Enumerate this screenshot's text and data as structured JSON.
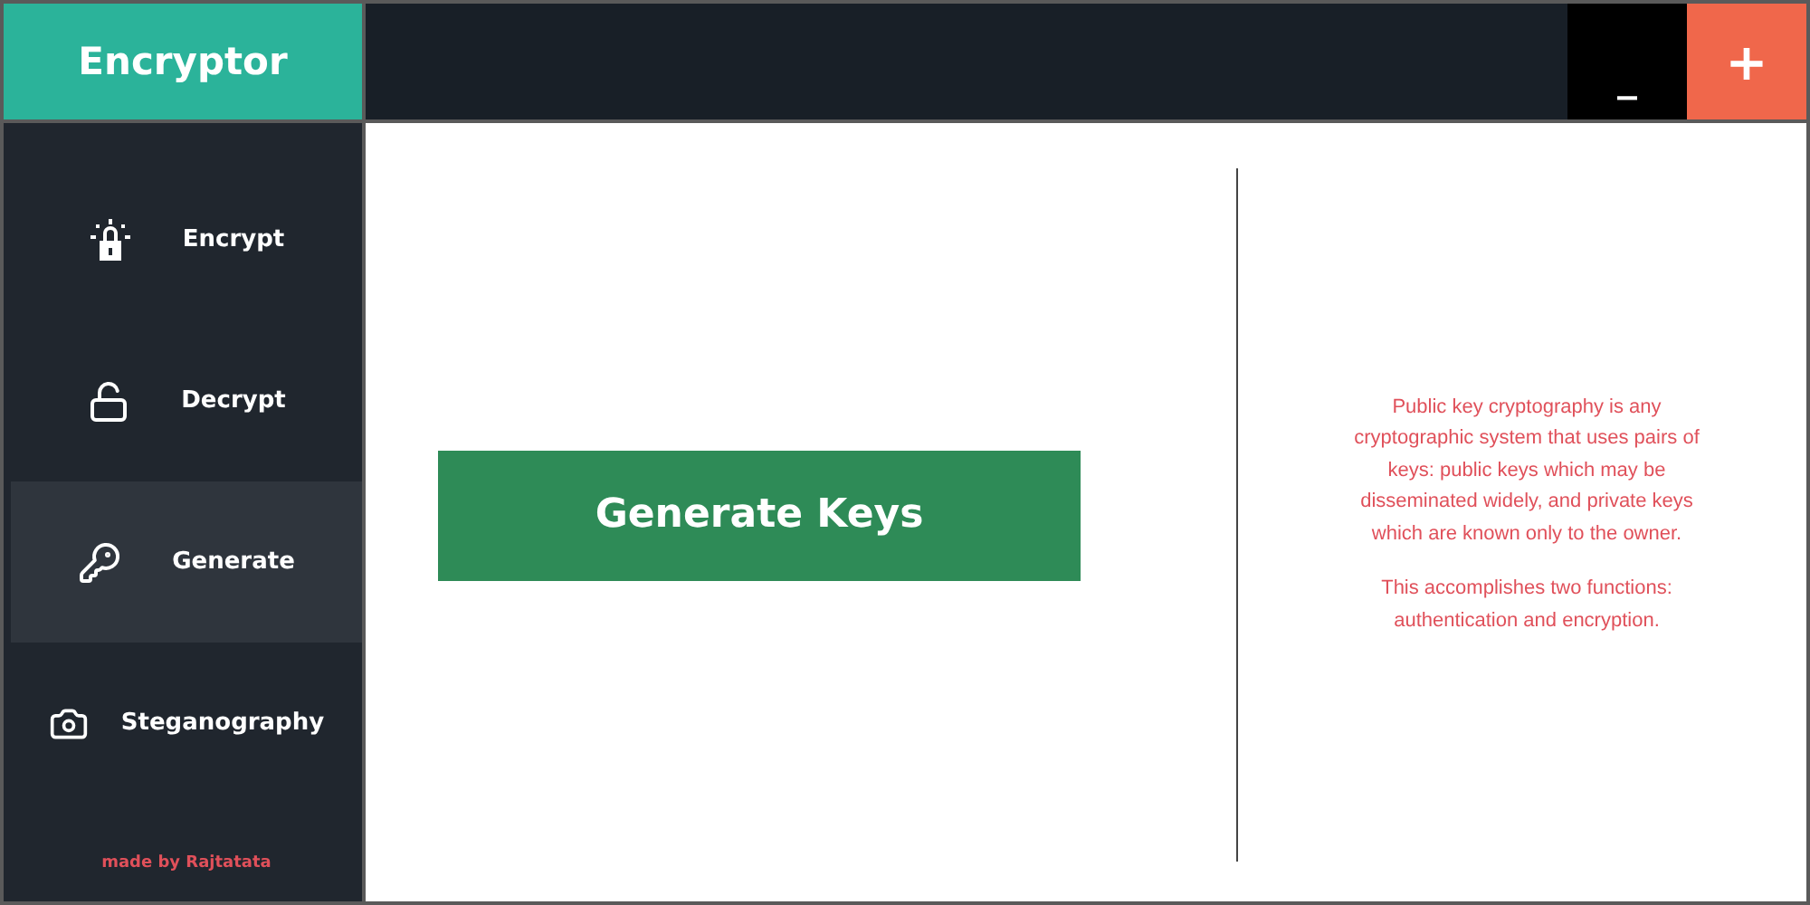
{
  "app_title": "Encryptor",
  "window_buttons": [
    {
      "kind": "minimize",
      "label": "_"
    },
    {
      "kind": "close",
      "label": "+"
    }
  ],
  "sidebar": {
    "items": [
      {
        "label": "Encrypt",
        "kind": "encrypt",
        "selected": false
      },
      {
        "label": "Decrypt",
        "kind": "decrypt",
        "selected": false
      },
      {
        "label": "Generate",
        "kind": "generate",
        "selected": true
      },
      {
        "label": "Steganography",
        "kind": "steganography",
        "selected": false
      }
    ],
    "credit": "made by Rajtatata"
  },
  "main": {
    "button": "Generate Keys",
    "info": [
      "Public key cryptography is any cryptographic system that uses pairs of keys: public keys which may be disseminated widely, and private keys which are known only to the owner.",
      "This accomplishes two functions: authentication and encryption."
    ]
  }
}
